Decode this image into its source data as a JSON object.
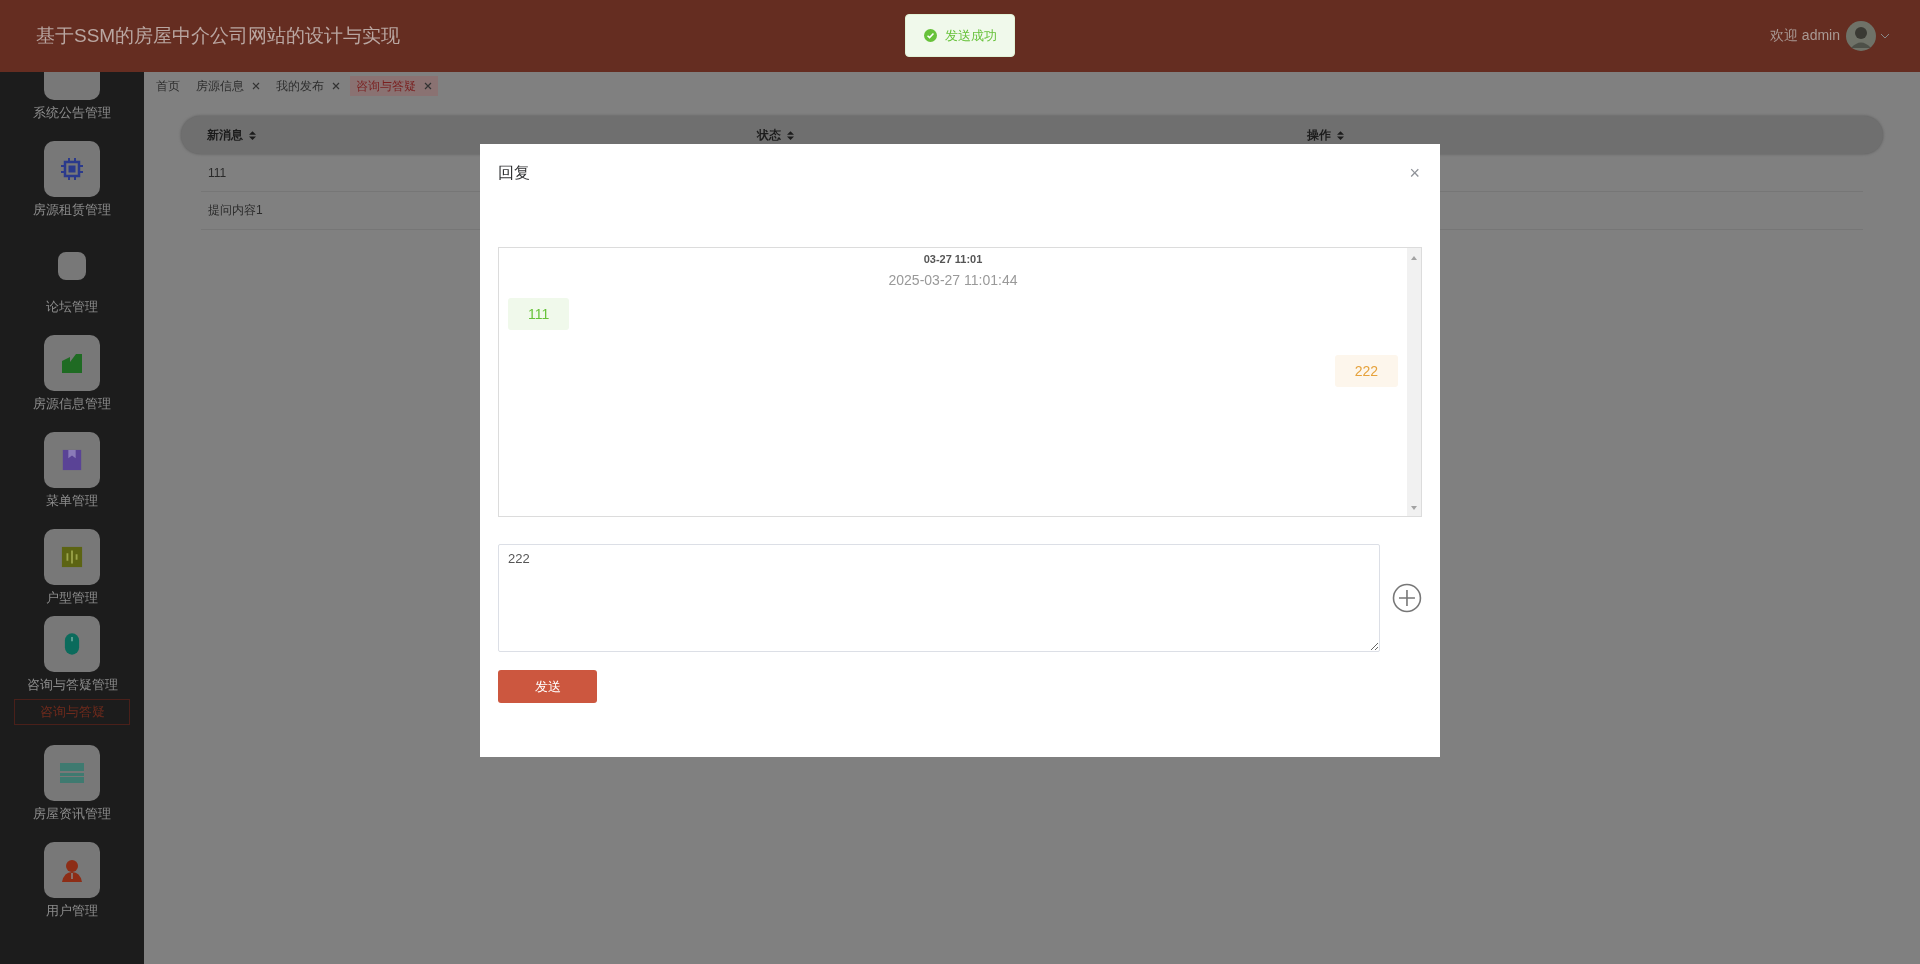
{
  "header": {
    "title": "基于SSM的房屋中介公司网站的设计与实现",
    "welcome": "欢迎 admin"
  },
  "toast": {
    "message": "发送成功"
  },
  "sidebar": {
    "items": [
      {
        "label": "系统公告管理"
      },
      {
        "label": "房源租赁管理"
      },
      {
        "label": "论坛管理"
      },
      {
        "label": "房源信息管理"
      },
      {
        "label": "菜单管理"
      },
      {
        "label": "户型管理"
      },
      {
        "label": "咨询与答疑管理",
        "children": [
          {
            "label": "咨询与答疑",
            "selected": true
          }
        ]
      },
      {
        "label": "房屋资讯管理"
      },
      {
        "label": "用户管理"
      }
    ]
  },
  "tabs": [
    {
      "label": "首页",
      "closable": false,
      "selected": false
    },
    {
      "label": "房源信息",
      "closable": true,
      "selected": false
    },
    {
      "label": "我的发布",
      "closable": true,
      "selected": false
    },
    {
      "label": "咨询与答疑",
      "closable": true,
      "selected": true
    }
  ],
  "table": {
    "columns": [
      "新消息",
      "状态",
      "操作"
    ],
    "rows": [
      {
        "cells": [
          "111"
        ]
      },
      {
        "cells": [
          "提问内容1"
        ]
      }
    ]
  },
  "dialog": {
    "title": "回复",
    "close": "×",
    "chat": {
      "short_time": "03-27 11:01",
      "full_time": "2025-03-27 11:01:44",
      "messages": [
        {
          "kind": "received",
          "text": "111"
        },
        {
          "kind": "sent",
          "text": "222"
        }
      ]
    },
    "input": {
      "value": "222"
    },
    "send_button": "发送"
  }
}
